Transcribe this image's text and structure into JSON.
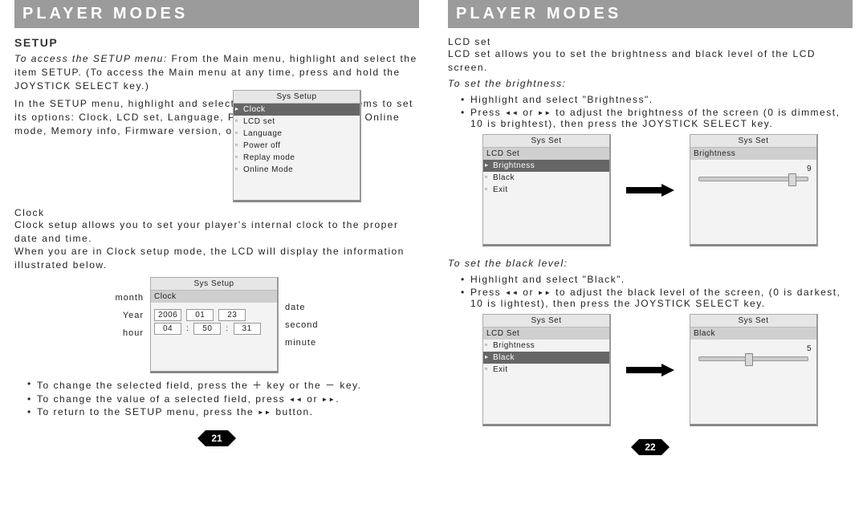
{
  "left": {
    "header": "PLAYER MODES",
    "setup_heading": "SETUP",
    "intro_em": "To access the SETUP menu:",
    "intro_rest": " From the Main menu, highlight and select the item SETUP. (To access the Main menu at any time, press and hold the JOYSTICK SELECT key.)",
    "para2": "In the SETUP menu, highlight and select one of the following items to set its options: Clock, LCD set, Language, Power off, Replay mode, Online mode, Memory info, Firmware version, or Firmware upgrade.",
    "sys_setup_title": "Sys Setup",
    "sys_setup_items": [
      "Clock",
      "LCD set",
      "Language",
      "Power off",
      "Replay mode",
      "Online Mode"
    ],
    "clock_heading": "Clock",
    "clock_para1": "Clock setup allows you to set your player's internal clock to the proper date and time.",
    "clock_para2": "When you are in Clock setup mode, the LCD will display the information illustrated below.",
    "clock_lcd_title": "Sys Setup",
    "clock_lcd_sub": "Clock",
    "clock_labels": {
      "month": "month",
      "year": "Year",
      "date": "date",
      "hour": "hour",
      "second": "second",
      "minute": "minute"
    },
    "clock_vals": {
      "y": "2006",
      "mo": "01",
      "d": "23",
      "h": "04",
      "mi": "50",
      "s": "31"
    },
    "bul1a": "To change the selected field, press the ",
    "bul1_plus": "＋",
    "bul1b": " key or the ",
    "bul1_minus": "－",
    "bul1c": " key.",
    "bul2a": "To change the value of a selected field, press ",
    "bul2_prev": "◂◂",
    "bul2b": " or ",
    "bul2_next": "▸▸",
    "bul2c": ".",
    "bul3a": "To return to the SETUP menu, press the ",
    "bul3_btn": "▸▸",
    "bul3b": " button.",
    "page_num": "21"
  },
  "right": {
    "header": "PLAYER MODES",
    "lcd_heading": "LCD set",
    "lcd_para": "LCD set allows you to set the brightness and black level of the LCD screen.",
    "bright_em": "To set the brightness:",
    "bright_b1": "Highlight and select \"Brightness\".",
    "bright_b2a": "Press ",
    "bright_b2_prev": "◂◂",
    "bright_b2b": " or ",
    "bright_b2_next": "▸▸",
    "bright_b2c": " to adjust the brightness of the screen (0 is dimmest, 10 is brightest), then press the JOYSTICK SELECT key.",
    "sysset_title": "Sys Set",
    "lcdset_sub": "LCD Set",
    "lcdset_items1": [
      "Brightness",
      "Black",
      "Exit"
    ],
    "brightness_label": "Brightness",
    "brightness_val": "9",
    "black_em": "To set the black level:",
    "black_b1": "Highlight and select \"Black\".",
    "black_b2a": "Press ",
    "black_b2_prev": "◂◂",
    "black_b2b": " or ",
    "black_b2_next": "▸▸",
    "black_b2c": " to adjust the black level of the screen, (0 is darkest, 10 is lightest), then press the JOYSTICK SELECT key.",
    "lcdset_items2": [
      "Brightness",
      "Black",
      "Exit"
    ],
    "black_label": "Black",
    "black_val": "5",
    "page_num": "22"
  }
}
